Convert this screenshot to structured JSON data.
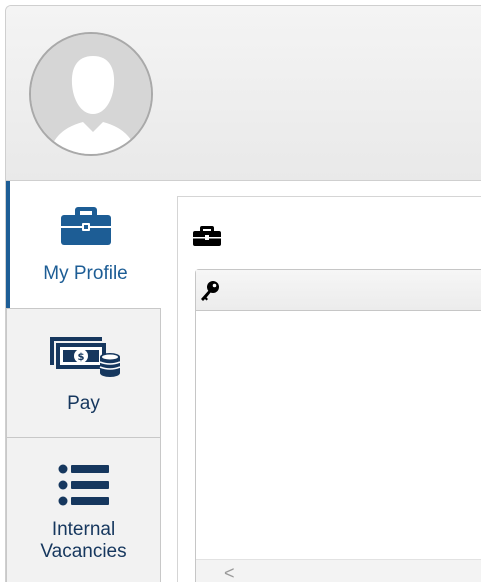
{
  "header": {
    "avatar_icon": "user-silhouette-icon"
  },
  "sidebar": {
    "items": [
      {
        "label": "My Profile",
        "icon": "briefcase-icon",
        "active": true
      },
      {
        "label": "Pay",
        "icon": "money-coins-icon",
        "active": false
      },
      {
        "label": "Internal Vacancies",
        "icon": "list-icon",
        "active": false
      }
    ]
  },
  "content": {
    "header_icon": "briefcase-icon",
    "panel": {
      "header_icon": "key-icon",
      "scroll_left": "<"
    }
  },
  "colors": {
    "accent": "#1d5d95",
    "nav_text": "#16375e",
    "sidebar_inactive_bg": "#f2f2f2"
  }
}
